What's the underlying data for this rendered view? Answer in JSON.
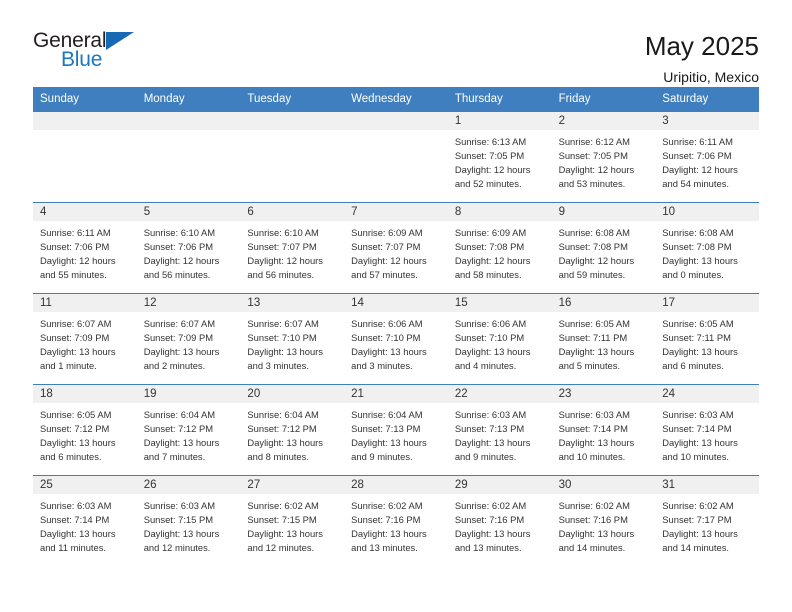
{
  "logo": {
    "word1": "General",
    "word2": "Blue",
    "triangle_color": "#1669b2",
    "word2_color": "#1a78c2"
  },
  "header": {
    "title": "May 2025",
    "subtitle": "Uripitio, Mexico"
  },
  "theme": {
    "header_bar_color": "#3f7fbf",
    "day_number_bar_color": "#f0f0f0",
    "text_color": "#333333"
  },
  "weekdays": [
    "Sunday",
    "Monday",
    "Tuesday",
    "Wednesday",
    "Thursday",
    "Friday",
    "Saturday"
  ],
  "weeks": [
    [
      {
        "day": "",
        "sunrise": "",
        "sunset": "",
        "daylight1": "",
        "daylight2": ""
      },
      {
        "day": "",
        "sunrise": "",
        "sunset": "",
        "daylight1": "",
        "daylight2": ""
      },
      {
        "day": "",
        "sunrise": "",
        "sunset": "",
        "daylight1": "",
        "daylight2": ""
      },
      {
        "day": "",
        "sunrise": "",
        "sunset": "",
        "daylight1": "",
        "daylight2": ""
      },
      {
        "day": "1",
        "sunrise": "Sunrise: 6:13 AM",
        "sunset": "Sunset: 7:05 PM",
        "daylight1": "Daylight: 12 hours",
        "daylight2": "and 52 minutes."
      },
      {
        "day": "2",
        "sunrise": "Sunrise: 6:12 AM",
        "sunset": "Sunset: 7:05 PM",
        "daylight1": "Daylight: 12 hours",
        "daylight2": "and 53 minutes."
      },
      {
        "day": "3",
        "sunrise": "Sunrise: 6:11 AM",
        "sunset": "Sunset: 7:06 PM",
        "daylight1": "Daylight: 12 hours",
        "daylight2": "and 54 minutes."
      }
    ],
    [
      {
        "day": "4",
        "sunrise": "Sunrise: 6:11 AM",
        "sunset": "Sunset: 7:06 PM",
        "daylight1": "Daylight: 12 hours",
        "daylight2": "and 55 minutes."
      },
      {
        "day": "5",
        "sunrise": "Sunrise: 6:10 AM",
        "sunset": "Sunset: 7:06 PM",
        "daylight1": "Daylight: 12 hours",
        "daylight2": "and 56 minutes."
      },
      {
        "day": "6",
        "sunrise": "Sunrise: 6:10 AM",
        "sunset": "Sunset: 7:07 PM",
        "daylight1": "Daylight: 12 hours",
        "daylight2": "and 56 minutes."
      },
      {
        "day": "7",
        "sunrise": "Sunrise: 6:09 AM",
        "sunset": "Sunset: 7:07 PM",
        "daylight1": "Daylight: 12 hours",
        "daylight2": "and 57 minutes."
      },
      {
        "day": "8",
        "sunrise": "Sunrise: 6:09 AM",
        "sunset": "Sunset: 7:08 PM",
        "daylight1": "Daylight: 12 hours",
        "daylight2": "and 58 minutes."
      },
      {
        "day": "9",
        "sunrise": "Sunrise: 6:08 AM",
        "sunset": "Sunset: 7:08 PM",
        "daylight1": "Daylight: 12 hours",
        "daylight2": "and 59 minutes."
      },
      {
        "day": "10",
        "sunrise": "Sunrise: 6:08 AM",
        "sunset": "Sunset: 7:08 PM",
        "daylight1": "Daylight: 13 hours",
        "daylight2": "and 0 minutes."
      }
    ],
    [
      {
        "day": "11",
        "sunrise": "Sunrise: 6:07 AM",
        "sunset": "Sunset: 7:09 PM",
        "daylight1": "Daylight: 13 hours",
        "daylight2": "and 1 minute."
      },
      {
        "day": "12",
        "sunrise": "Sunrise: 6:07 AM",
        "sunset": "Sunset: 7:09 PM",
        "daylight1": "Daylight: 13 hours",
        "daylight2": "and 2 minutes."
      },
      {
        "day": "13",
        "sunrise": "Sunrise: 6:07 AM",
        "sunset": "Sunset: 7:10 PM",
        "daylight1": "Daylight: 13 hours",
        "daylight2": "and 3 minutes."
      },
      {
        "day": "14",
        "sunrise": "Sunrise: 6:06 AM",
        "sunset": "Sunset: 7:10 PM",
        "daylight1": "Daylight: 13 hours",
        "daylight2": "and 3 minutes."
      },
      {
        "day": "15",
        "sunrise": "Sunrise: 6:06 AM",
        "sunset": "Sunset: 7:10 PM",
        "daylight1": "Daylight: 13 hours",
        "daylight2": "and 4 minutes."
      },
      {
        "day": "16",
        "sunrise": "Sunrise: 6:05 AM",
        "sunset": "Sunset: 7:11 PM",
        "daylight1": "Daylight: 13 hours",
        "daylight2": "and 5 minutes."
      },
      {
        "day": "17",
        "sunrise": "Sunrise: 6:05 AM",
        "sunset": "Sunset: 7:11 PM",
        "daylight1": "Daylight: 13 hours",
        "daylight2": "and 6 minutes."
      }
    ],
    [
      {
        "day": "18",
        "sunrise": "Sunrise: 6:05 AM",
        "sunset": "Sunset: 7:12 PM",
        "daylight1": "Daylight: 13 hours",
        "daylight2": "and 6 minutes."
      },
      {
        "day": "19",
        "sunrise": "Sunrise: 6:04 AM",
        "sunset": "Sunset: 7:12 PM",
        "daylight1": "Daylight: 13 hours",
        "daylight2": "and 7 minutes."
      },
      {
        "day": "20",
        "sunrise": "Sunrise: 6:04 AM",
        "sunset": "Sunset: 7:12 PM",
        "daylight1": "Daylight: 13 hours",
        "daylight2": "and 8 minutes."
      },
      {
        "day": "21",
        "sunrise": "Sunrise: 6:04 AM",
        "sunset": "Sunset: 7:13 PM",
        "daylight1": "Daylight: 13 hours",
        "daylight2": "and 9 minutes."
      },
      {
        "day": "22",
        "sunrise": "Sunrise: 6:03 AM",
        "sunset": "Sunset: 7:13 PM",
        "daylight1": "Daylight: 13 hours",
        "daylight2": "and 9 minutes."
      },
      {
        "day": "23",
        "sunrise": "Sunrise: 6:03 AM",
        "sunset": "Sunset: 7:14 PM",
        "daylight1": "Daylight: 13 hours",
        "daylight2": "and 10 minutes."
      },
      {
        "day": "24",
        "sunrise": "Sunrise: 6:03 AM",
        "sunset": "Sunset: 7:14 PM",
        "daylight1": "Daylight: 13 hours",
        "daylight2": "and 10 minutes."
      }
    ],
    [
      {
        "day": "25",
        "sunrise": "Sunrise: 6:03 AM",
        "sunset": "Sunset: 7:14 PM",
        "daylight1": "Daylight: 13 hours",
        "daylight2": "and 11 minutes."
      },
      {
        "day": "26",
        "sunrise": "Sunrise: 6:03 AM",
        "sunset": "Sunset: 7:15 PM",
        "daylight1": "Daylight: 13 hours",
        "daylight2": "and 12 minutes."
      },
      {
        "day": "27",
        "sunrise": "Sunrise: 6:02 AM",
        "sunset": "Sunset: 7:15 PM",
        "daylight1": "Daylight: 13 hours",
        "daylight2": "and 12 minutes."
      },
      {
        "day": "28",
        "sunrise": "Sunrise: 6:02 AM",
        "sunset": "Sunset: 7:16 PM",
        "daylight1": "Daylight: 13 hours",
        "daylight2": "and 13 minutes."
      },
      {
        "day": "29",
        "sunrise": "Sunrise: 6:02 AM",
        "sunset": "Sunset: 7:16 PM",
        "daylight1": "Daylight: 13 hours",
        "daylight2": "and 13 minutes."
      },
      {
        "day": "30",
        "sunrise": "Sunrise: 6:02 AM",
        "sunset": "Sunset: 7:16 PM",
        "daylight1": "Daylight: 13 hours",
        "daylight2": "and 14 minutes."
      },
      {
        "day": "31",
        "sunrise": "Sunrise: 6:02 AM",
        "sunset": "Sunset: 7:17 PM",
        "daylight1": "Daylight: 13 hours",
        "daylight2": "and 14 minutes."
      }
    ]
  ]
}
